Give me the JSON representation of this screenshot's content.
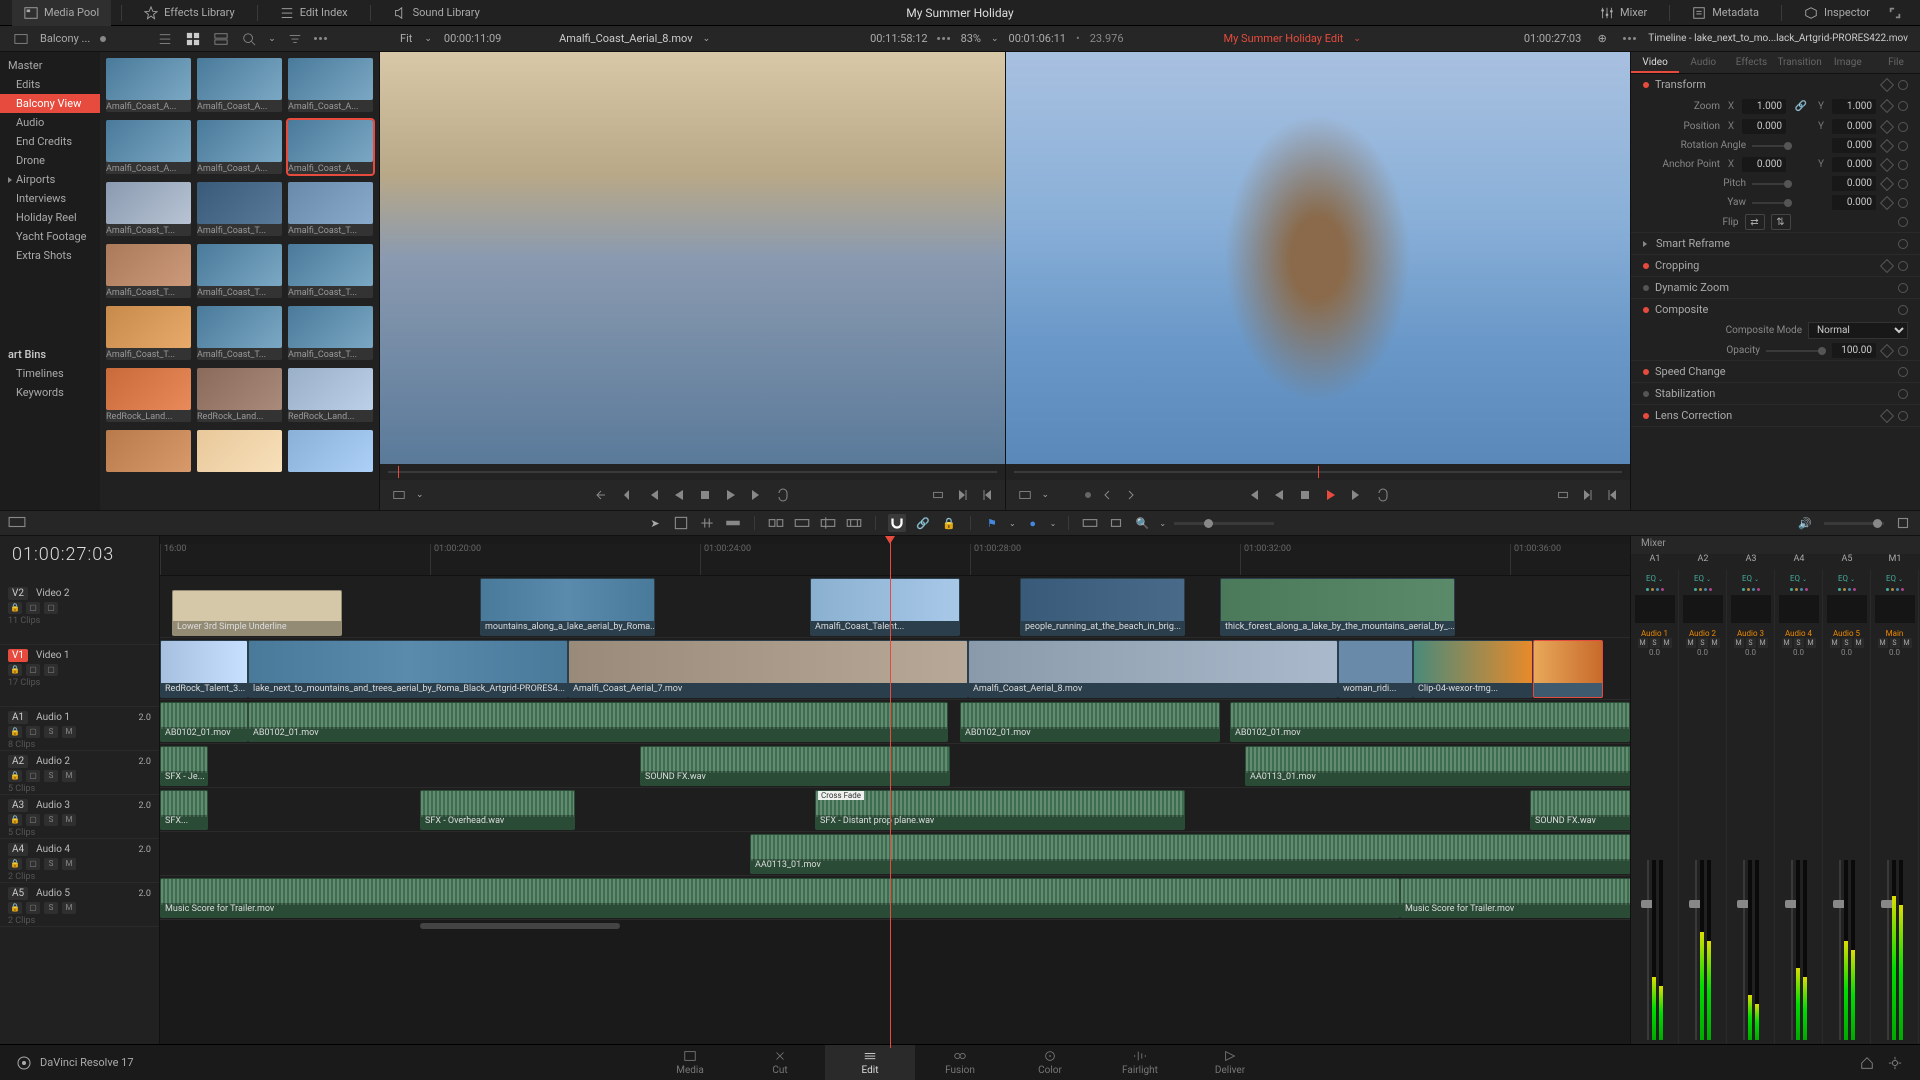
{
  "project_title": "My Summer Holiday",
  "app_name": "DaVinci Resolve 17",
  "top_tabs": {
    "media_pool": "Media Pool",
    "effects_library": "Effects Library",
    "edit_index": "Edit Index",
    "sound_library": "Sound Library",
    "mixer": "Mixer",
    "metadata": "Metadata",
    "inspector": "Inspector"
  },
  "toolbar2": {
    "bin_name": "Balcony ...",
    "fit": "Fit",
    "source_tc": "00:00:11:09",
    "source_clip": "Amalfi_Coast_Aerial_8.mov",
    "program_tc_left": "00:11:58:12",
    "zoom_pct": "83%",
    "program_tc_mid": "00:01:06:11",
    "fps_info": "23.976",
    "timeline_name": "My Summer Holiday Edit",
    "program_tc_right": "01:00:27:03",
    "inspector_title": "Timeline - lake_next_to_mo...lack_Artgrid-PRORES422.mov"
  },
  "bins": {
    "master": "Master",
    "items": [
      "Edits",
      "Balcony View",
      "Audio",
      "End Credits",
      "Drone",
      "Airports",
      "Interviews",
      "Holiday Reel",
      "Yacht Footage",
      "Extra Shots"
    ],
    "smart_bins": "art Bins",
    "smart_items": [
      "Timelines",
      "Keywords"
    ]
  },
  "thumbs": [
    "Amalfi_Coast_A...",
    "Amalfi_Coast_A...",
    "Amalfi_Coast_A...",
    "Amalfi_Coast_A...",
    "Amalfi_Coast_A...",
    "Amalfi_Coast_A...",
    "Amalfi_Coast_T...",
    "Amalfi_Coast_T...",
    "Amalfi_Coast_T...",
    "Amalfi_Coast_T...",
    "Amalfi_Coast_T...",
    "Amalfi_Coast_T...",
    "Amalfi_Coast_T...",
    "Amalfi_Coast_T...",
    "Amalfi_Coast_T...",
    "RedRock_Land...",
    "RedRock_Land...",
    "RedRock_Land..."
  ],
  "inspector_tabs": [
    "Video",
    "Audio",
    "Effects",
    "Transition",
    "Image",
    "File"
  ],
  "inspector": {
    "transform": "Transform",
    "zoom": "Zoom",
    "position": "Position",
    "rotation": "Rotation Angle",
    "anchor": "Anchor Point",
    "pitch": "Pitch",
    "yaw": "Yaw",
    "flip": "Flip",
    "zoom_x": "1.000",
    "zoom_y": "1.000",
    "pos_x": "0.000",
    "pos_y": "0.000",
    "rot": "0.000",
    "anchor_x": "0.000",
    "anchor_y": "0.000",
    "pitch_v": "0.000",
    "yaw_v": "0.000",
    "smart_reframe": "Smart Reframe",
    "cropping": "Cropping",
    "dynamic_zoom": "Dynamic Zoom",
    "composite": "Composite",
    "composite_mode_lbl": "Composite Mode",
    "composite_mode": "Normal",
    "opacity_lbl": "Opacity",
    "opacity": "100.00",
    "speed_change": "Speed Change",
    "stabilization": "Stabilization",
    "lens_correction": "Lens Correction",
    "x": "X",
    "y": "Y"
  },
  "timeline": {
    "tc": "01:00:27:03",
    "ruler": [
      "16:00",
      "01:00:20:00",
      "01:00:24:00",
      "01:00:28:00",
      "01:00:32:00",
      "01:00:36:00"
    ],
    "tracks": {
      "v2": {
        "badge": "V2",
        "name": "Video 2",
        "count": "11 Clips"
      },
      "v1": {
        "badge": "V1",
        "name": "Video 1",
        "count": "17 Clips"
      },
      "a1": {
        "badge": "A1",
        "name": "Audio 1",
        "count": "8 Clips"
      },
      "a2": {
        "badge": "A2",
        "name": "Audio 2",
        "count": "5 Clips"
      },
      "a3": {
        "badge": "A3",
        "name": "Audio 3",
        "count": "5 Clips"
      },
      "a4": {
        "badge": "A4",
        "name": "Audio 4",
        "count": "2 Clips"
      },
      "a5": {
        "badge": "A5",
        "name": "Audio 5",
        "count": "2 Clips"
      }
    },
    "clips": {
      "title": "Lower 3rd Simple Underline",
      "v2a": "mountains_along_a_lake_aerial_by_Roma...",
      "v2b": "Amalfi_Coast_Talent...",
      "v2c": "people_running_at_the_beach_in_brig...",
      "v2d": "thick_forest_along_a_lake_by_the_mountains_aerial_by_...",
      "v1a": "RedRock_Talent_3...",
      "v1b": "lake_next_to_mountains_and_trees_aerial_by_Roma_Black_Artgrid-PRORES4...",
      "v1c": "Amalfi_Coast_Aerial_7.mov",
      "v1d": "Amalfi_Coast_Aerial_8.mov",
      "v1e": "woman_ridi...",
      "v1f": "Clip-04-wexor-tmg...",
      "a1a": "AB0102_01.mov",
      "a1b": "AB0102_01.mov",
      "a1c": "AB0102_01.mov",
      "a1d": "AB0102_01.mov",
      "a2a": "SFX - Je...",
      "a2b": "SOUND FX.wav",
      "a2c": "AA0113_01.mov",
      "a3a": "SFX...",
      "a3b": "SFX - Overhead.wav",
      "a3c": "SFX - Distant prop plane.wav",
      "a3d": "SOUND FX.wav",
      "cross_fade": "Cross Fade",
      "a4a": "AA0113_01.mov",
      "a5a": "Music Score for Trailer.mov",
      "a5b": "Music Score for Trailer.mov"
    }
  },
  "mixer": {
    "title": "Mixer",
    "channels": [
      "A1",
      "A2",
      "A3",
      "A4",
      "A5",
      "M1"
    ],
    "eq": "EQ",
    "audio_labels": [
      "Audio 1",
      "Audio 2",
      "Audio 3",
      "Audio 4",
      "Audio 5",
      "Main"
    ],
    "db": "0.0",
    "msm": [
      "M",
      "S",
      "M"
    ],
    "meter_levels": [
      35,
      60,
      25,
      40,
      55,
      80
    ]
  },
  "pages": [
    "Media",
    "Cut",
    "Edit",
    "Fusion",
    "Color",
    "Fairlight",
    "Deliver"
  ]
}
